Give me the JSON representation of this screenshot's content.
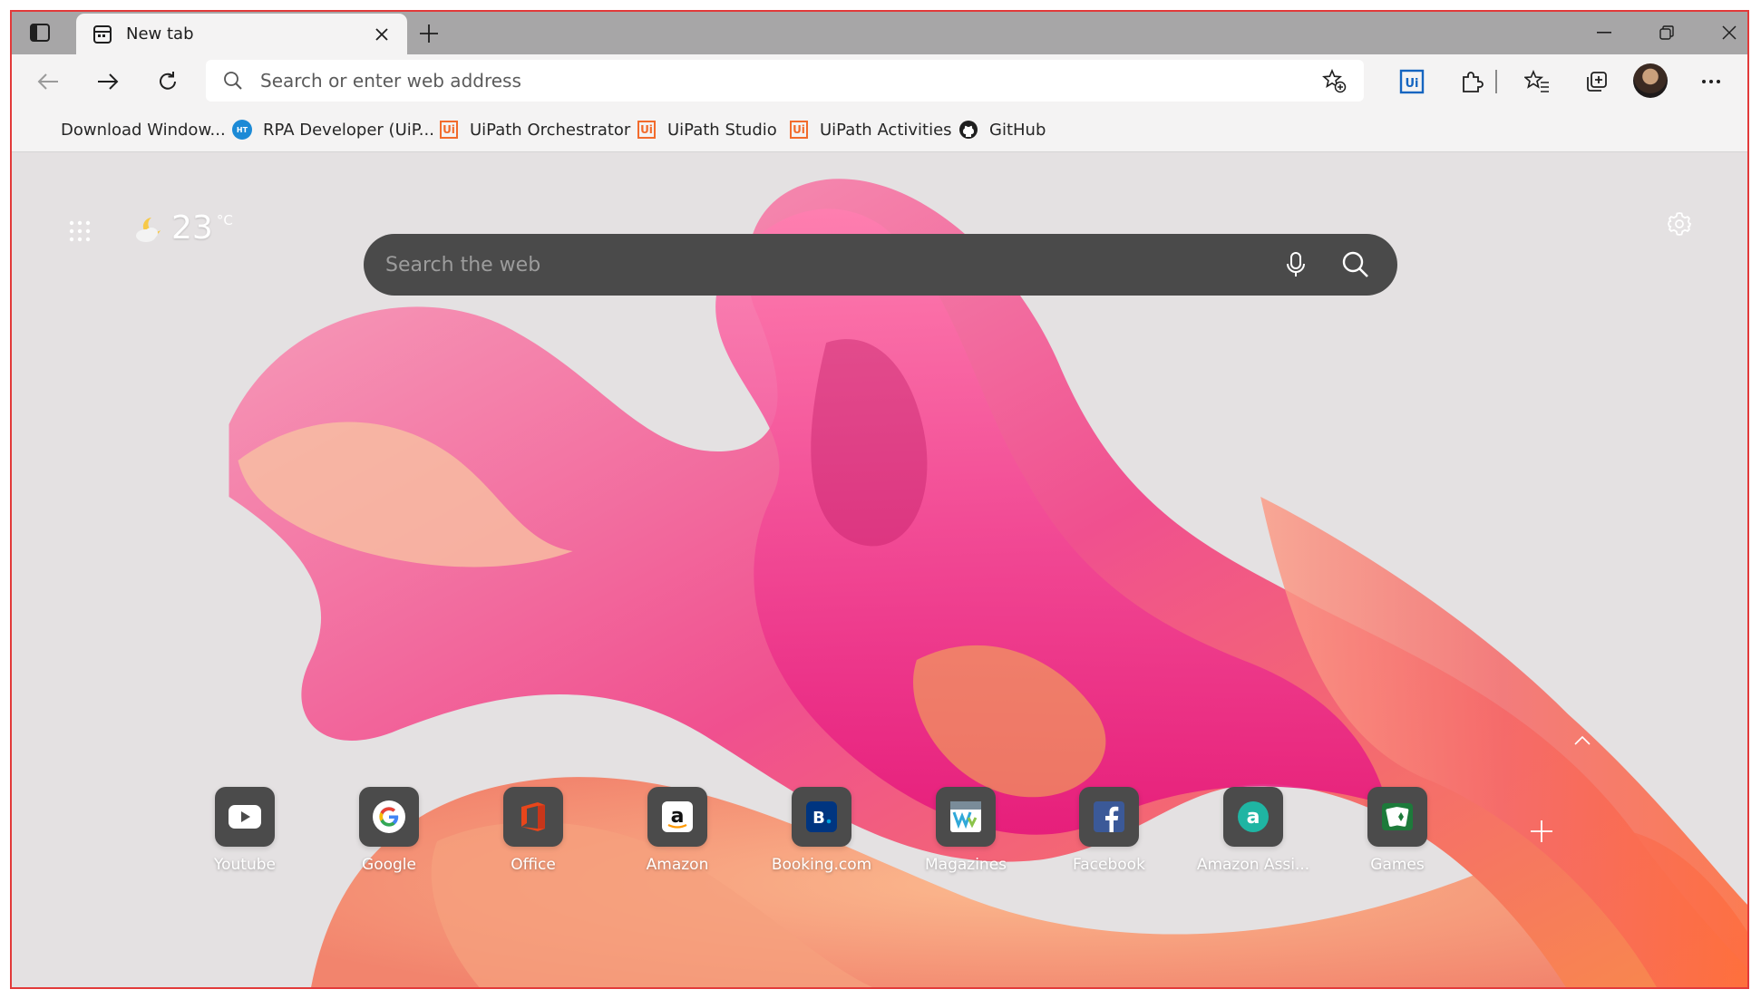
{
  "tab": {
    "title": "New tab"
  },
  "address_bar": {
    "placeholder": "Search or enter web address"
  },
  "bookmarks": [
    {
      "label": "Download Window..."
    },
    {
      "label": "RPA Developer (UiP..."
    },
    {
      "label": "UiPath Orchestrator"
    },
    {
      "label": "UiPath Studio"
    },
    {
      "label": "UiPath Activities"
    },
    {
      "label": "GitHub"
    }
  ],
  "weather": {
    "temperature": "23",
    "unit": "°C"
  },
  "web_search": {
    "placeholder": "Search the web"
  },
  "quick_links": [
    {
      "label": "Youtube"
    },
    {
      "label": "Google"
    },
    {
      "label": "Office"
    },
    {
      "label": "Amazon"
    },
    {
      "label": "Booking.com"
    },
    {
      "label": "Magazines"
    },
    {
      "label": "Facebook"
    },
    {
      "label": "Amazon Assi..."
    },
    {
      "label": "Games"
    }
  ],
  "icons": {
    "tab_actions": "tab-actions-icon",
    "favicon": "new-tab-page-icon",
    "close": "close-icon",
    "new_tab": "plus-icon",
    "back": "back-arrow-icon",
    "forward": "forward-arrow-icon",
    "refresh": "refresh-icon",
    "search": "search-icon",
    "add_favorite": "star-plus-icon",
    "uipath_ext": "uipath-extension-icon",
    "extensions": "puzzle-icon",
    "favorites": "favorites-icon",
    "collections": "collections-icon",
    "more": "more-icon",
    "mic": "microphone-icon",
    "settings": "gear-icon",
    "apps": "app-launcher-icon",
    "weather": "partly-cloudy-night-icon"
  },
  "colors": {
    "frame_border": "#e23a3a",
    "tab_strip": "#a7a6a7",
    "toolbar": "#f4f3f3",
    "uipath_orange": "#f26b2c",
    "uipath_blue": "#1565c0"
  }
}
